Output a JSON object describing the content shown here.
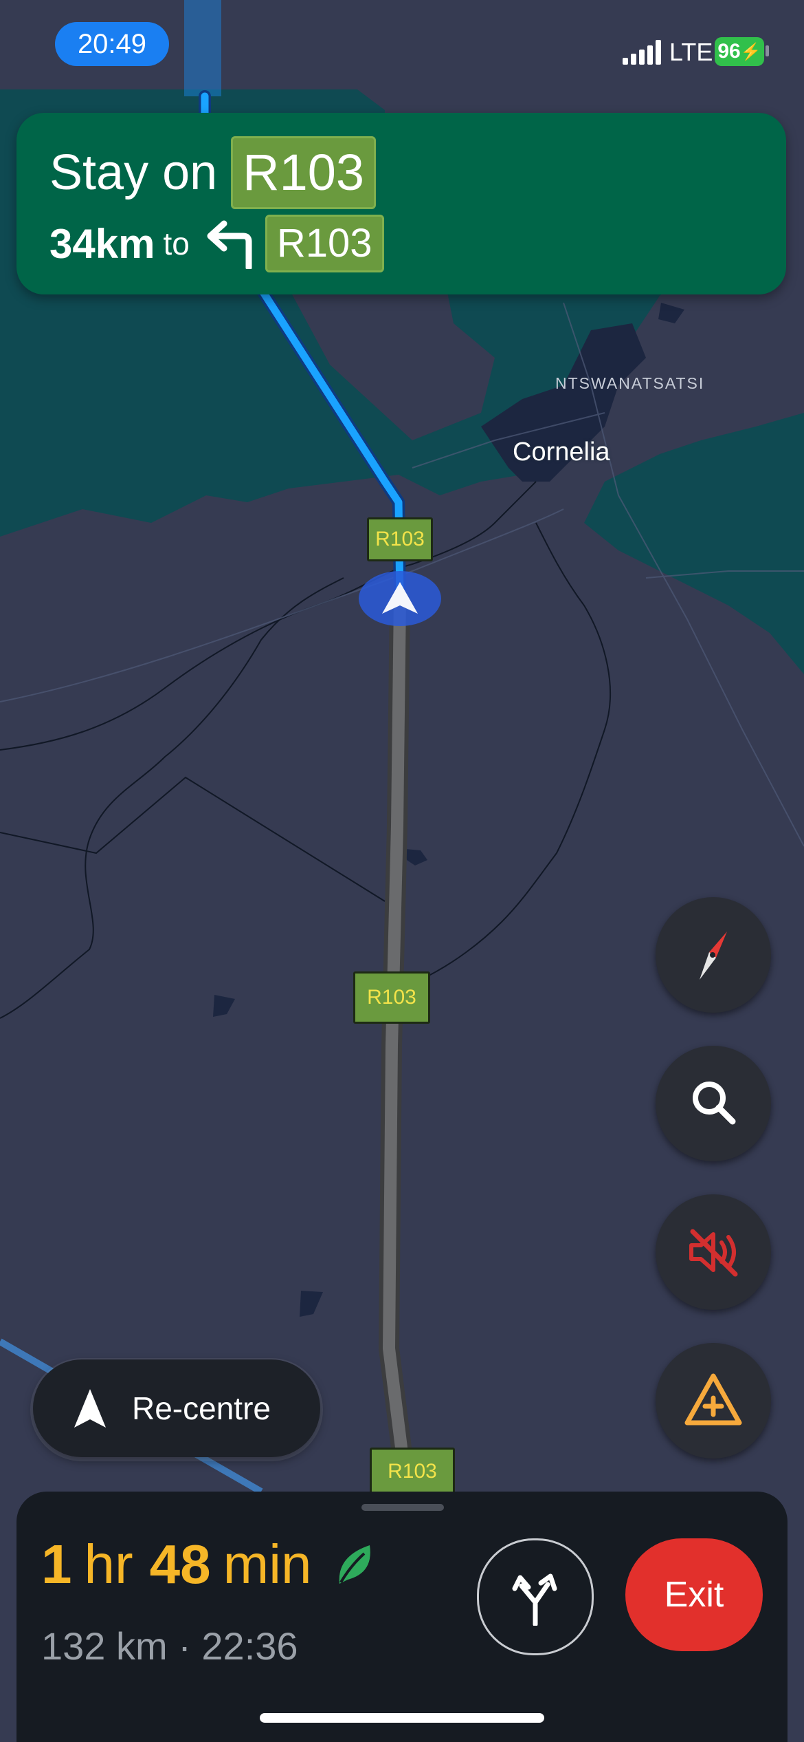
{
  "status_bar": {
    "time": "20:49",
    "network": "LTE",
    "battery": "96"
  },
  "navigation": {
    "instruction_prefix": "Stay on",
    "instruction_road": "R103",
    "distance": "34km",
    "to_label": "to",
    "next_turn_icon": "turn-left-icon",
    "next_road": "R103"
  },
  "map": {
    "places": [
      "NTSWANATSATSI",
      "Cornelia"
    ],
    "road_shields": [
      "R103",
      "R103",
      "R103"
    ]
  },
  "controls": {
    "compass": "compass-icon",
    "search": "search-icon",
    "mute": "sound-off-icon",
    "report": "report-incident-icon",
    "recentre_label": "Re-centre"
  },
  "trip": {
    "hours": "1",
    "hours_unit": "hr",
    "minutes": "48",
    "minutes_unit": "min",
    "summary": "132 km · 22:36",
    "exit_label": "Exit"
  },
  "colors": {
    "banner": "#006548",
    "route_active": "#1aa3ff",
    "route_remaining": "#6a6b6d",
    "eta": "#f6b627",
    "exit": "#e2302c",
    "water": "#0f4a52"
  }
}
